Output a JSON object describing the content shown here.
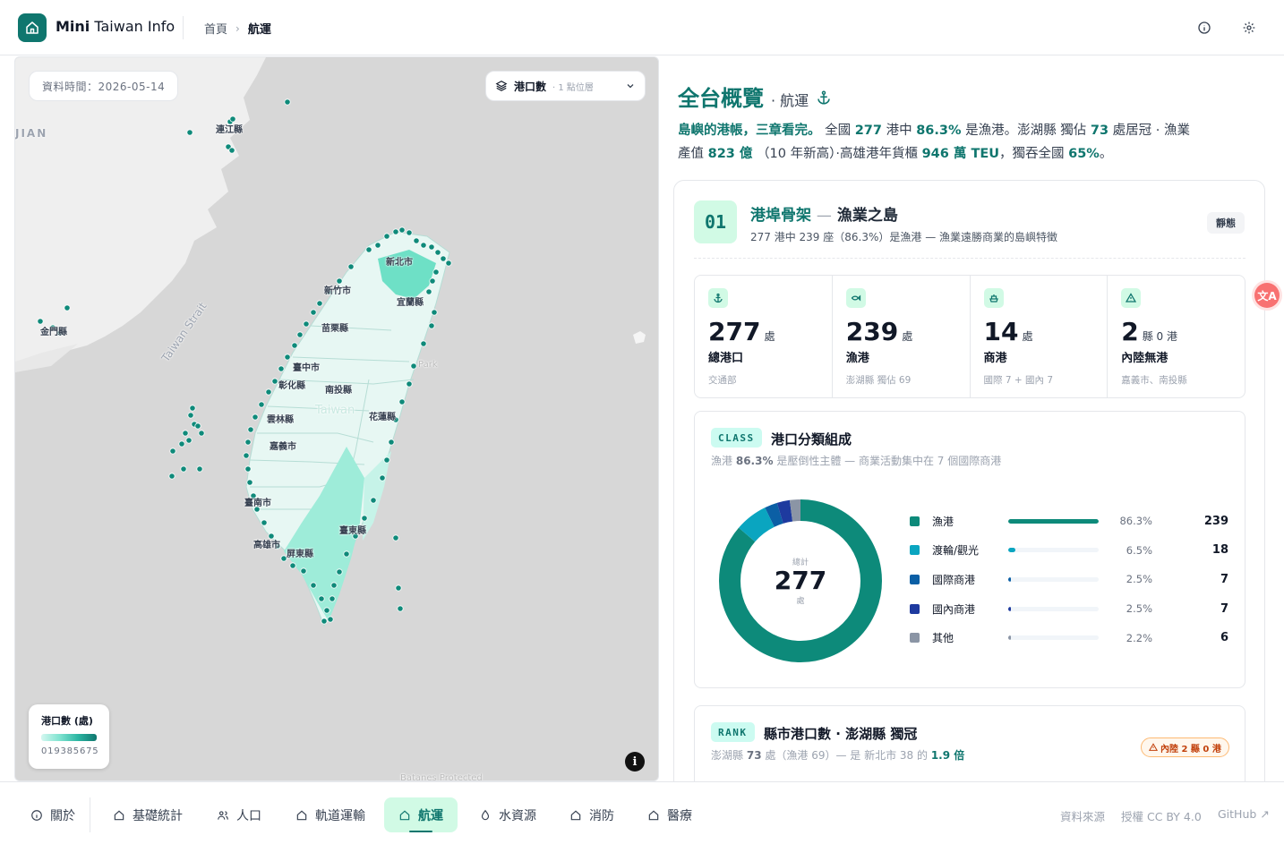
{
  "header": {
    "app_name_bold": "Mini",
    "app_name_rest": " Taiwan Info",
    "breadcrumb": [
      "首頁",
      "航運"
    ],
    "breadcrumb_sep": "›"
  },
  "map": {
    "data_time": "資料時間：2026-05-14",
    "layer_label": "港口數",
    "layer_sub": "· 1 點位層",
    "legend_title": "港口數 (處)",
    "legend_ticks": "019385675",
    "info": "i",
    "sea_labels": [
      "Taiwan Strait",
      "JIAN",
      "Taiwan",
      "Park",
      "Batanes Protected"
    ],
    "place_labels": [
      "連江縣",
      "金門縣",
      "新北市",
      "新竹市",
      "宜蘭縣",
      "苗栗縣",
      "臺中市",
      "彰化縣",
      "南投縣",
      "花蓮縣",
      "雲林縣",
      "嘉義市",
      "臺南市",
      "高雄市",
      "屏東縣",
      "臺東縣"
    ],
    "colors": {
      "port": "#0f8a7a",
      "land": "#e7f7f3",
      "high": "#6ee0c6",
      "sea": "#d7d7d7"
    }
  },
  "panel": {
    "title": "全台概覽",
    "subtitle": "· 航運",
    "lead_bold": "島嶼的港帳，三章看完。",
    "lead_1": "全國",
    "lead_277": "277",
    "lead_2": "港中",
    "lead_pct": "86.3%",
    "lead_3": "是漁港。澎湖縣 獨佔",
    "lead_73": "73",
    "lead_4": "處居冠 · 漁業產值",
    "lead_823": "823 億",
    "lead_5": "（10 年新高）·高雄港年貨櫃",
    "lead_teu": "946 萬 TEU",
    "lead_6": "，獨吞全國",
    "lead_65": "65%",
    "lead_7": "。"
  },
  "section1": {
    "num": "01",
    "title_a": "港埠骨架",
    "title_dash": "—",
    "title_b": "漁業之島",
    "subtitle": "277 港中 239 座（86.3%）是漁港 — 漁業遠勝商業的島嶼特徵",
    "badge": "靜態"
  },
  "stats": [
    {
      "icon": "anchor-icon",
      "value": "277",
      "unit": "處",
      "label": "總港口",
      "note": "交通部"
    },
    {
      "icon": "fish-icon",
      "value": "239",
      "unit": "處",
      "label": "漁港",
      "note": "澎湖縣 獨佔 69"
    },
    {
      "icon": "ship-icon",
      "value": "14",
      "unit": "處",
      "label": "商港",
      "note": "國際 7 + 國內 7"
    },
    {
      "icon": "warning-icon",
      "value": "2",
      "unit": "縣 0 港",
      "label": "內陸無港",
      "note": "嘉義市、南投縣"
    }
  ],
  "class_card": {
    "tag": "CLASS",
    "title": "港口分類組成",
    "sub_a": "漁港",
    "sub_pct": "86.3%",
    "sub_b": "是壓倒性主體 — 商業活動集中在 7 個國際商港",
    "center_label": "總計",
    "center_value": "277",
    "center_unit": "處"
  },
  "chart_data": {
    "type": "pie",
    "title": "港口分類組成",
    "total": 277,
    "categories": [
      "漁港",
      "渡輪/觀光",
      "國際商港",
      "國內商港",
      "其他"
    ],
    "values": [
      239,
      18,
      7,
      7,
      6
    ],
    "percents": [
      "86.3%",
      "6.5%",
      "2.5%",
      "2.5%",
      "2.2%"
    ],
    "percent_values": [
      86.3,
      6.5,
      2.5,
      2.5,
      2.2
    ],
    "colors": [
      "#0d8a7a",
      "#0aa5c0",
      "#0b5fa5",
      "#1e3a9f",
      "#8b95a5"
    ]
  },
  "rank_card": {
    "tag": "RANK",
    "title": "縣市港口數 · 澎湖縣 獨冠",
    "sub_a": "澎湖縣",
    "sub_73": "73",
    "sub_b": "處（漁港 69）— 是 新北市 38 的",
    "sub_ratio": "1.9 倍",
    "warn": "內陸 2 縣 0 港"
  },
  "float_btn": "文A",
  "nav": {
    "items": [
      {
        "label": "關於",
        "icon": "info-icon"
      },
      {
        "label": "基礎統計",
        "icon": "home-icon"
      },
      {
        "label": "人口",
        "icon": "people-icon"
      },
      {
        "label": "軌道運輸",
        "icon": "home-icon"
      },
      {
        "label": "航運",
        "icon": "home-icon"
      },
      {
        "label": "水資源",
        "icon": "drop-icon"
      },
      {
        "label": "消防",
        "icon": "home-icon"
      },
      {
        "label": "醫療",
        "icon": "home-icon"
      }
    ],
    "active": "航運",
    "links": [
      "資料來源",
      "授權 CC BY 4.0",
      "GitHub ↗"
    ]
  }
}
